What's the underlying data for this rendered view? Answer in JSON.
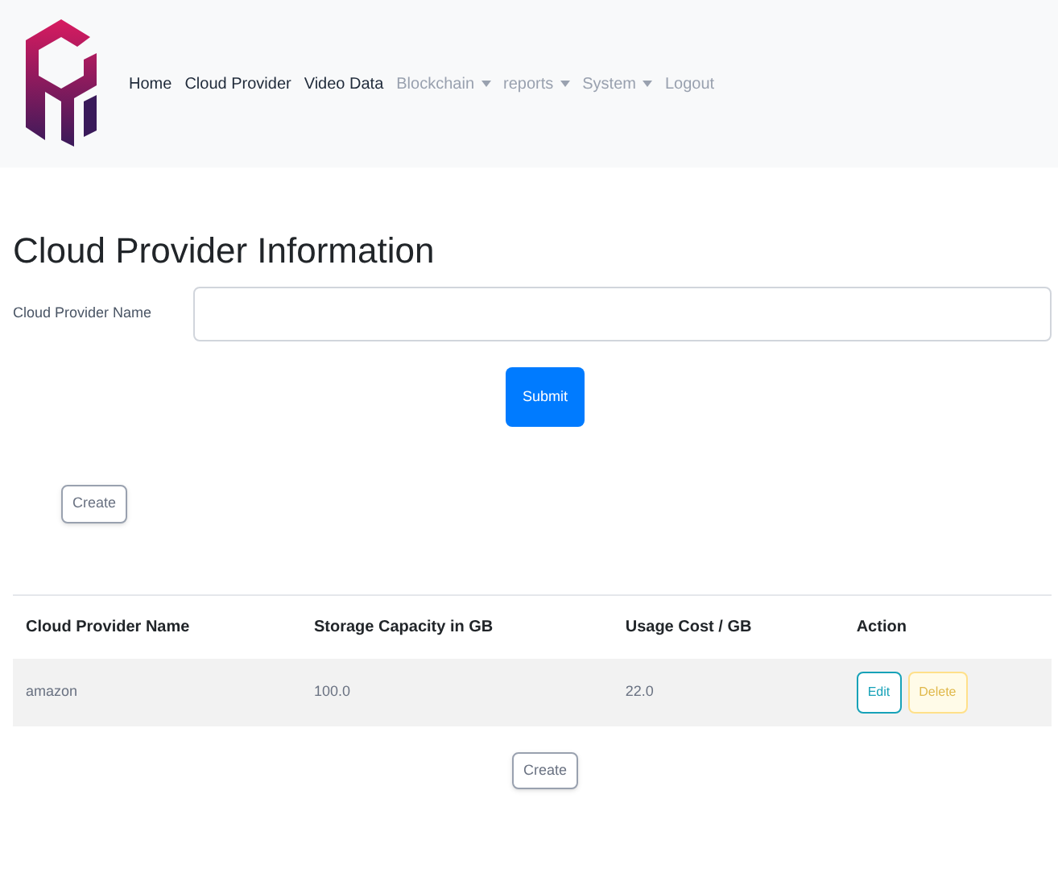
{
  "nav": {
    "items": [
      {
        "label": "Home",
        "dimmed": false,
        "dropdown": false
      },
      {
        "label": "Cloud Provider",
        "dimmed": false,
        "dropdown": false
      },
      {
        "label": "Video Data",
        "dimmed": false,
        "dropdown": false
      },
      {
        "label": "Blockchain",
        "dimmed": true,
        "dropdown": true
      },
      {
        "label": "reports",
        "dimmed": true,
        "dropdown": true
      },
      {
        "label": "System",
        "dimmed": true,
        "dropdown": true
      },
      {
        "label": "Logout",
        "dimmed": true,
        "dropdown": false
      }
    ]
  },
  "title": "Cloud Provider Information",
  "form": {
    "label": "Cloud Provider Name",
    "submit": "Submit"
  },
  "create_top": "Create",
  "table": {
    "columns": [
      "Cloud Provider Name",
      "Storage Capacity in GB",
      "Usage Cost / GB",
      "Action"
    ],
    "rows": [
      {
        "cells": [
          "amazon",
          "100.0",
          "22.0"
        ],
        "actions": [
          {
            "label": "Edit",
            "kind": "edit"
          },
          {
            "label": "Delete",
            "kind": "delete"
          }
        ]
      }
    ]
  },
  "create_bottom": "Create"
}
